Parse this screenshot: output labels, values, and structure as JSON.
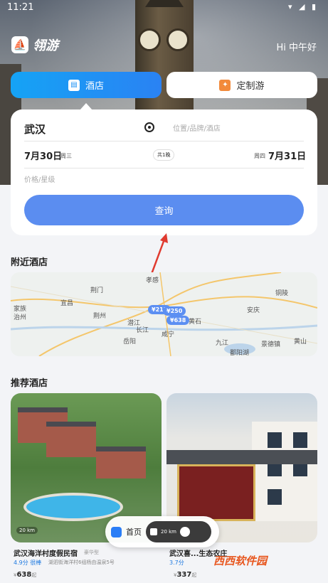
{
  "status_bar": {
    "time": "11:21"
  },
  "header": {
    "app_name": "翎游",
    "greeting": "Hi 中午好"
  },
  "tabs": [
    {
      "label": "酒店"
    },
    {
      "label": "定制游"
    }
  ],
  "search": {
    "city": "武汉",
    "keyword_placeholder": "位置/品牌/酒店",
    "checkin_date": "7月30日",
    "checkin_weekday": "周三",
    "nights": "共1晚",
    "checkout_weekday": "周四",
    "checkout_date": "7月31日",
    "price_placeholder": "价格/星级",
    "query_label": "查询"
  },
  "nearby": {
    "title": "附近酒店",
    "map_labels": [
      "孝感",
      "荆门",
      "宜昌",
      "荆州",
      "家族",
      "治州",
      "潜江",
      "长江",
      "岳阳",
      "咸宁",
      "黄石",
      "九江",
      "安庆",
      "铜陵",
      "景德镇",
      "黄山",
      "鄱阳湖"
    ],
    "pins": [
      "¥213",
      "¥250",
      "¥638"
    ]
  },
  "recommended": {
    "title": "推荐酒店",
    "hotels": [
      {
        "name": "武汉海洋村度假民宿",
        "star": "豪华型",
        "score": "4.9分 很棒",
        "address": "湖泗街海洋村6组杨由温泉5号",
        "price": "638",
        "price_suffix": "起",
        "distance": "20 km"
      },
      {
        "name": "武汉喜...生态农庄",
        "score": "3.7分",
        "price": "337",
        "price_suffix": "起",
        "distance": "20 km"
      }
    ]
  },
  "bottom_nav": {
    "home_label": "首页",
    "distance": "20 km"
  },
  "watermark": "西西软件园",
  "colors": {
    "primary": "#2a7ef6",
    "query_button": "#5b8df0",
    "tour_icon": "#f28a3b",
    "arrow": "#e03a2f"
  }
}
